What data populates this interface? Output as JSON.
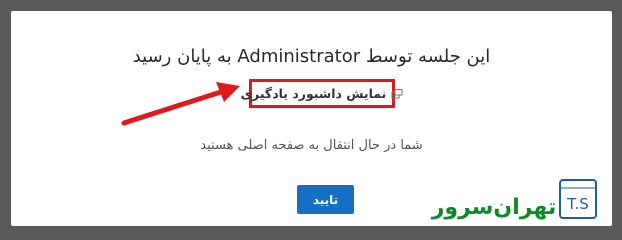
{
  "dialog": {
    "title": "این جلسه توسط Administrator به پایان رسید",
    "dashboard_link_label": "نمایش داشبورد یادگیری",
    "info_text": "شما در حال انتقال به صفحه اصلی هستید",
    "confirm_label": "تایید"
  },
  "watermark": {
    "text": "تهران‌سرور",
    "badge": "T.S",
    "color": "#0c8a2a",
    "badge_color": "#1c5fa8"
  },
  "colors": {
    "highlight": "#e0191c",
    "button": "#1570c4",
    "backdrop": "#5a5a5a"
  }
}
